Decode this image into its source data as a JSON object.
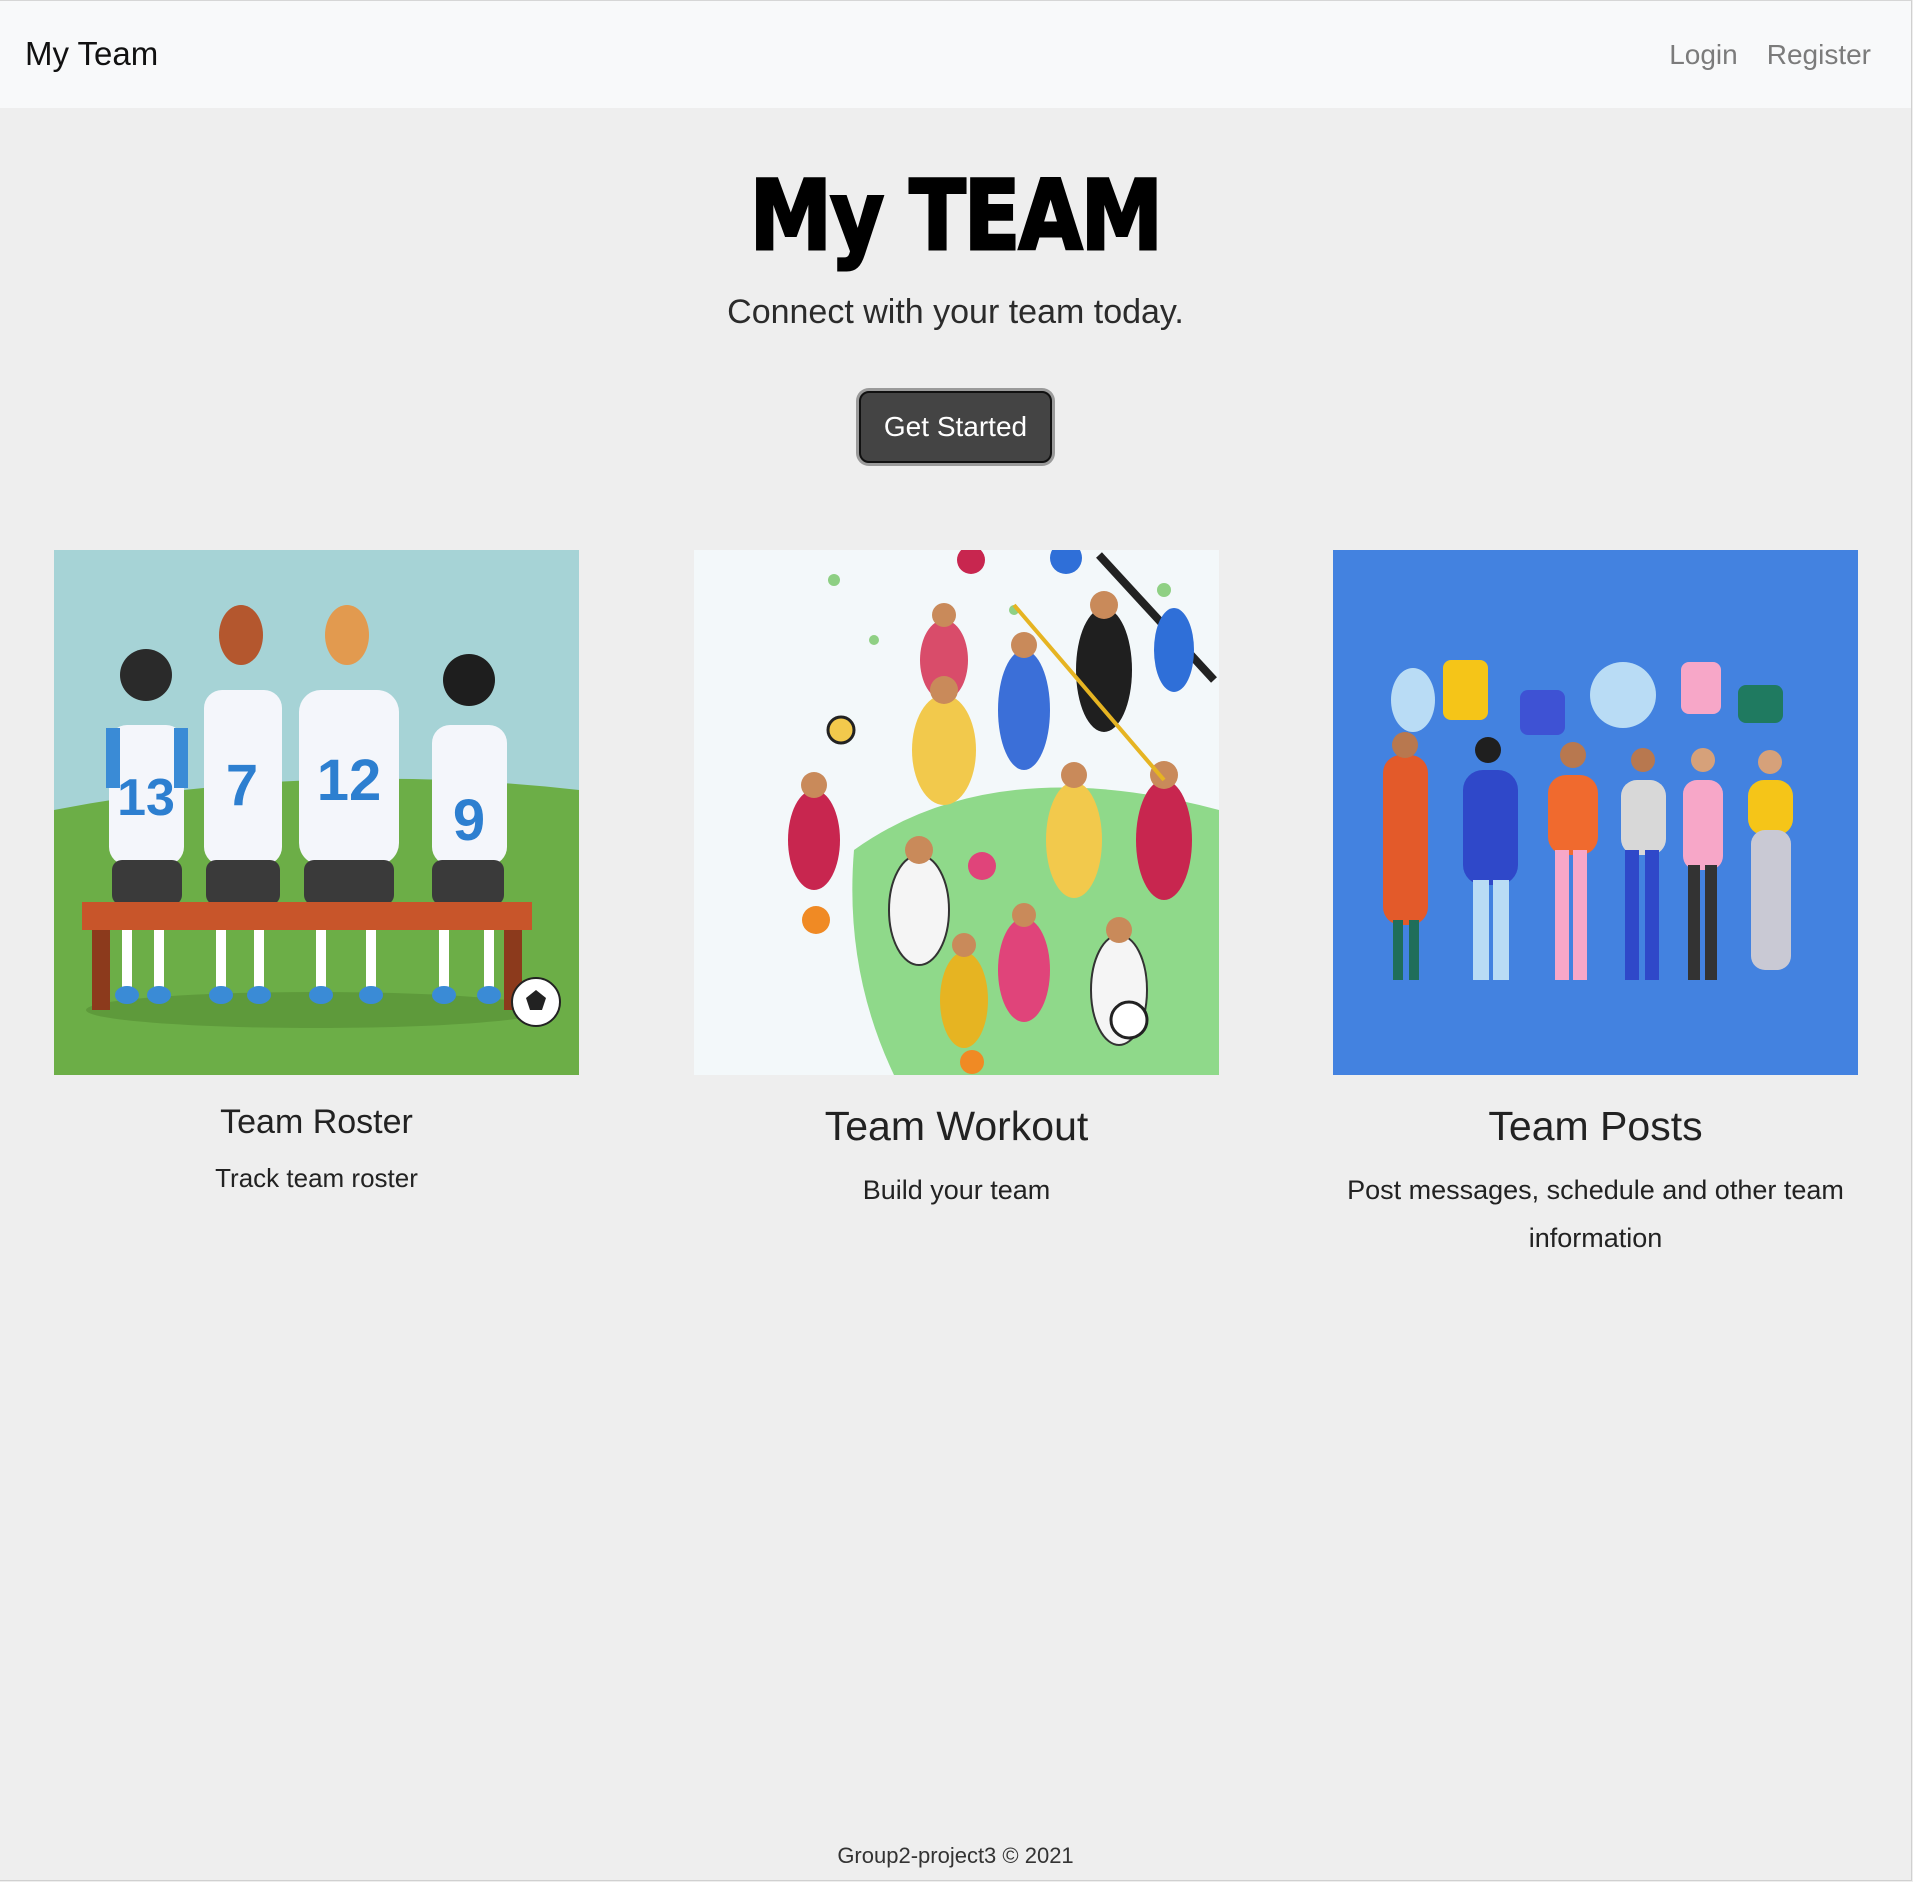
{
  "navbar": {
    "brand": "My Team",
    "links": [
      "Login",
      "Register"
    ]
  },
  "hero": {
    "title": "My TEAM",
    "subtitle": "Connect with your team today.",
    "button_label": "Get Started"
  },
  "cards": [
    {
      "title": "Team Roster",
      "text": "Track team roster",
      "image": "team-bench-illustration",
      "jersey_numbers": [
        "13",
        "7",
        "12",
        "9"
      ]
    },
    {
      "title": "Team Workout",
      "text": "Build your team",
      "image": "athletes-collage-illustration"
    },
    {
      "title": "Team Posts",
      "text": "Post messages, schedule and other team information",
      "image": "people-chat-bubbles-illustration"
    }
  ],
  "footer": {
    "text": "Group2-project3 © 2021"
  },
  "colors": {
    "page_background": "#eeeeee",
    "navbar_background": "#f8f9fa",
    "button_background": "#444444",
    "posts_image_background": "#4382e0",
    "roster_sky": "#a6d3d6",
    "roster_grass": "#6cae47"
  }
}
